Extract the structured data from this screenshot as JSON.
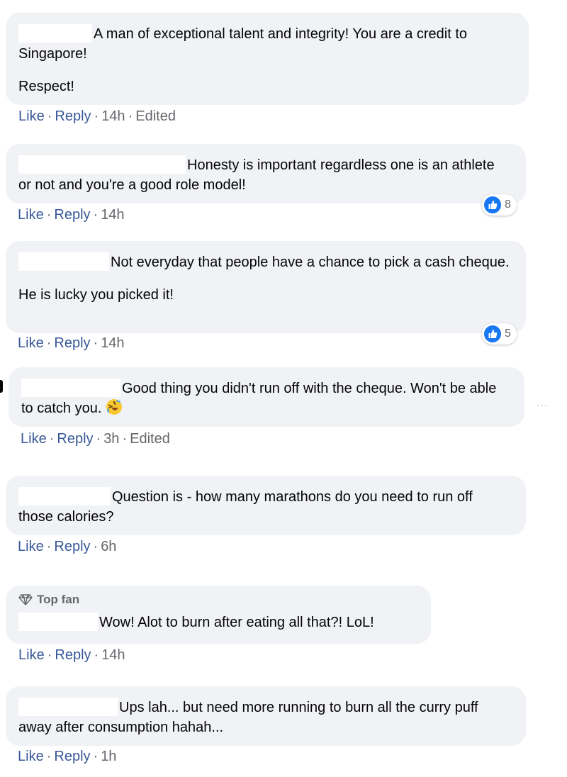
{
  "comments": [
    {
      "lines": [
        "A man of exceptional talent and integrity! You are a credit to Singapore!",
        "Respect!"
      ],
      "actions": {
        "like": "Like",
        "reply": "Reply",
        "time": "14h",
        "edited": "Edited"
      }
    },
    {
      "lines": [
        "Honesty is important regardless one is an athlete or not and you're a good role model!"
      ],
      "reaction_count": "8",
      "actions": {
        "like": "Like",
        "reply": "Reply",
        "time": "14h"
      }
    },
    {
      "lines": [
        "Not everyday that people have a chance to pick a cash cheque.",
        "He is lucky you picked it!"
      ],
      "reaction_count": "5",
      "actions": {
        "like": "Like",
        "reply": "Reply",
        "time": "14h"
      }
    },
    {
      "lines": [
        "Good thing you didn't run off with the cheque. Won't be able to catch you."
      ],
      "emoji": "rolling-on-floor-laughing-emoji",
      "actions": {
        "like": "Like",
        "reply": "Reply",
        "time": "3h",
        "edited": "Edited"
      }
    },
    {
      "lines": [
        "Question is - how many marathons do you need to run off those calories?"
      ],
      "actions": {
        "like": "Like",
        "reply": "Reply",
        "time": "6h"
      }
    },
    {
      "badge": "Top fan",
      "lines": [
        "Wow! Alot to burn after eating all that?! LoL!"
      ],
      "actions": {
        "like": "Like",
        "reply": "Reply",
        "time": "14h"
      }
    },
    {
      "lines": [
        "Ups lah... but need more running to burn all the curry puff away after consumption hahah..."
      ],
      "actions": {
        "like": "Like",
        "reply": "Reply",
        "time": "1h"
      }
    }
  ],
  "more_options": "...",
  "colors": {
    "bubble": "#f0f2f5",
    "link": "#385898",
    "meta": "#65676b",
    "like_blue": "#1877f2"
  },
  "icons": {
    "reaction": "like-thumb-icon",
    "badge": "diamond-icon",
    "more": "more-dots-icon"
  }
}
